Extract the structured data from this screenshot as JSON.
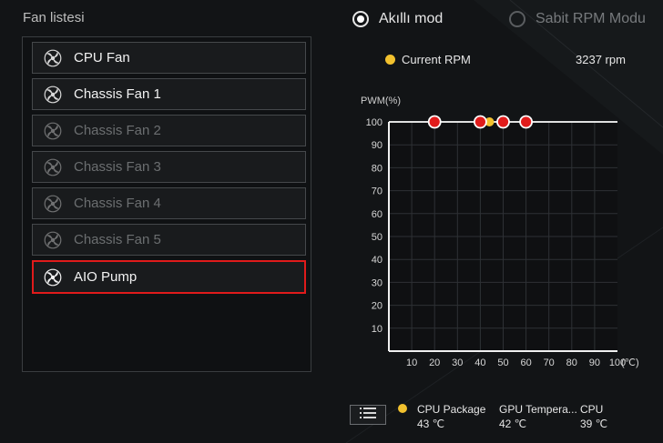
{
  "fan_list": {
    "title": "Fan listesi",
    "items": [
      {
        "label": "CPU Fan",
        "state": "enabled"
      },
      {
        "label": "Chassis Fan 1",
        "state": "enabled"
      },
      {
        "label": "Chassis Fan 2",
        "state": "disabled"
      },
      {
        "label": "Chassis Fan 3",
        "state": "disabled"
      },
      {
        "label": "Chassis Fan 4",
        "state": "disabled"
      },
      {
        "label": "Chassis Fan 5",
        "state": "disabled"
      },
      {
        "label": "AIO Pump",
        "state": "selected"
      }
    ],
    "icon": "fan-icon"
  },
  "mode": {
    "smart_label": "Akıllı mod",
    "smart_selected": true,
    "fixed_label": "Sabit RPM Modu",
    "fixed_selected": false
  },
  "current": {
    "label": "Current RPM",
    "value": "3237 rpm",
    "color": "#f2c12e"
  },
  "chart_data": {
    "type": "line",
    "ylabel": "PWM(%)",
    "xunit": "(℃)",
    "xlim": [
      0,
      100
    ],
    "ylim": [
      0,
      100
    ],
    "x_ticks": [
      "10",
      "20",
      "30",
      "40",
      "50",
      "60",
      "70",
      "80",
      "90",
      "100"
    ],
    "y_ticks": [
      "10",
      "20",
      "30",
      "40",
      "50",
      "60",
      "70",
      "80",
      "90",
      "100"
    ],
    "series": [
      {
        "x": [
          20,
          40,
          50,
          60
        ],
        "y": [
          100,
          100,
          100,
          100
        ],
        "color": "#e01b1b"
      }
    ],
    "current_point": {
      "x": 44,
      "y": 100,
      "color": "#f2c12e"
    },
    "grid": true
  },
  "sensors": {
    "button_icon": "list-icon",
    "items": [
      {
        "name": "CPU Package",
        "value": "43 ℃",
        "active": true
      },
      {
        "name": "GPU Tempera...",
        "value": "42 ℃",
        "active": false
      },
      {
        "name": "CPU",
        "value": "39 ℃",
        "active": false
      }
    ]
  },
  "colors": {
    "accent": "#e01b1b",
    "indicator": "#f2c12e"
  }
}
